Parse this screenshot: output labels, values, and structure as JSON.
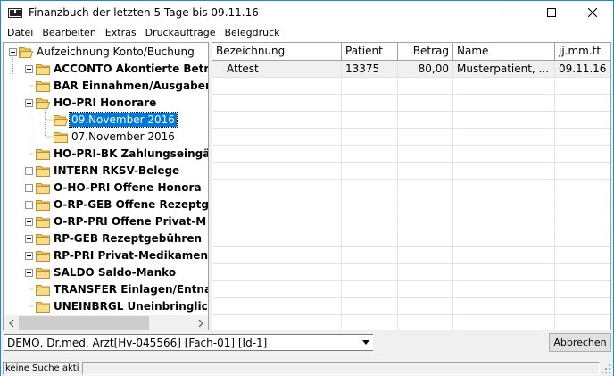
{
  "window": {
    "title": "Finanzbuch der letzten 5 Tage bis 09.11.16"
  },
  "menu": [
    "Datei",
    "Bearbeiten",
    "Extras",
    "Druckaufträge",
    "Belegdruck"
  ],
  "tree": {
    "root": "Aufzeichnung Konto/Buchung",
    "items": [
      {
        "label": "ACCONTO Akontierte Betr",
        "bold": true,
        "expander": "plus"
      },
      {
        "label": "BAR Einnahmen/Ausgaben",
        "bold": true,
        "expander": "none"
      },
      {
        "label": "HO-PRI Honorare",
        "bold": true,
        "expander": "minus"
      },
      {
        "label": "09.November 2016",
        "bold": false,
        "expander": "none",
        "selected": true
      },
      {
        "label": "07.November 2016",
        "bold": false,
        "expander": "none"
      },
      {
        "label": "HO-PRI-BK Zahlungseingär",
        "bold": true,
        "expander": "none"
      },
      {
        "label": "INTERN RKSV-Belege",
        "bold": true,
        "expander": "plus"
      },
      {
        "label": "O-HO-PRI Offene Honora",
        "bold": true,
        "expander": "plus"
      },
      {
        "label": "O-RP-GEB Offene Rezeptg",
        "bold": true,
        "expander": "plus"
      },
      {
        "label": "O-RP-PRI Offene Privat-M",
        "bold": true,
        "expander": "plus"
      },
      {
        "label": "RP-GEB Rezeptgebühren",
        "bold": true,
        "expander": "plus"
      },
      {
        "label": "RP-PRI Privat-Medikament",
        "bold": true,
        "expander": "plus"
      },
      {
        "label": "SALDO Saldo-Manko",
        "bold": true,
        "expander": "plus"
      },
      {
        "label": "TRANSFER Einlagen/Entnal",
        "bold": true,
        "expander": "none"
      },
      {
        "label": "UNEINBRGL Uneinbringlich",
        "bold": true,
        "expander": "none"
      }
    ]
  },
  "grid": {
    "columns": [
      "Bezeichnung",
      "Patient",
      "Betrag",
      "Name",
      "jj.mm.tt"
    ],
    "rows": [
      {
        "bezeichnung": "Attest",
        "patient": "13375",
        "betrag": "80,00",
        "name": "Musterpatient, ...",
        "datum": "09.11.16"
      }
    ]
  },
  "footer": {
    "combo_value": "DEMO, Dr.med. Arzt[Hv-045566] [Fach-01] [Id-1]",
    "cancel_label": "Abbrechen"
  },
  "status": {
    "text": "keine Suche aktiv"
  },
  "colors": {
    "selection": "#0078d7",
    "folder": "#f0c75e",
    "window_border": "#1e88d8"
  }
}
